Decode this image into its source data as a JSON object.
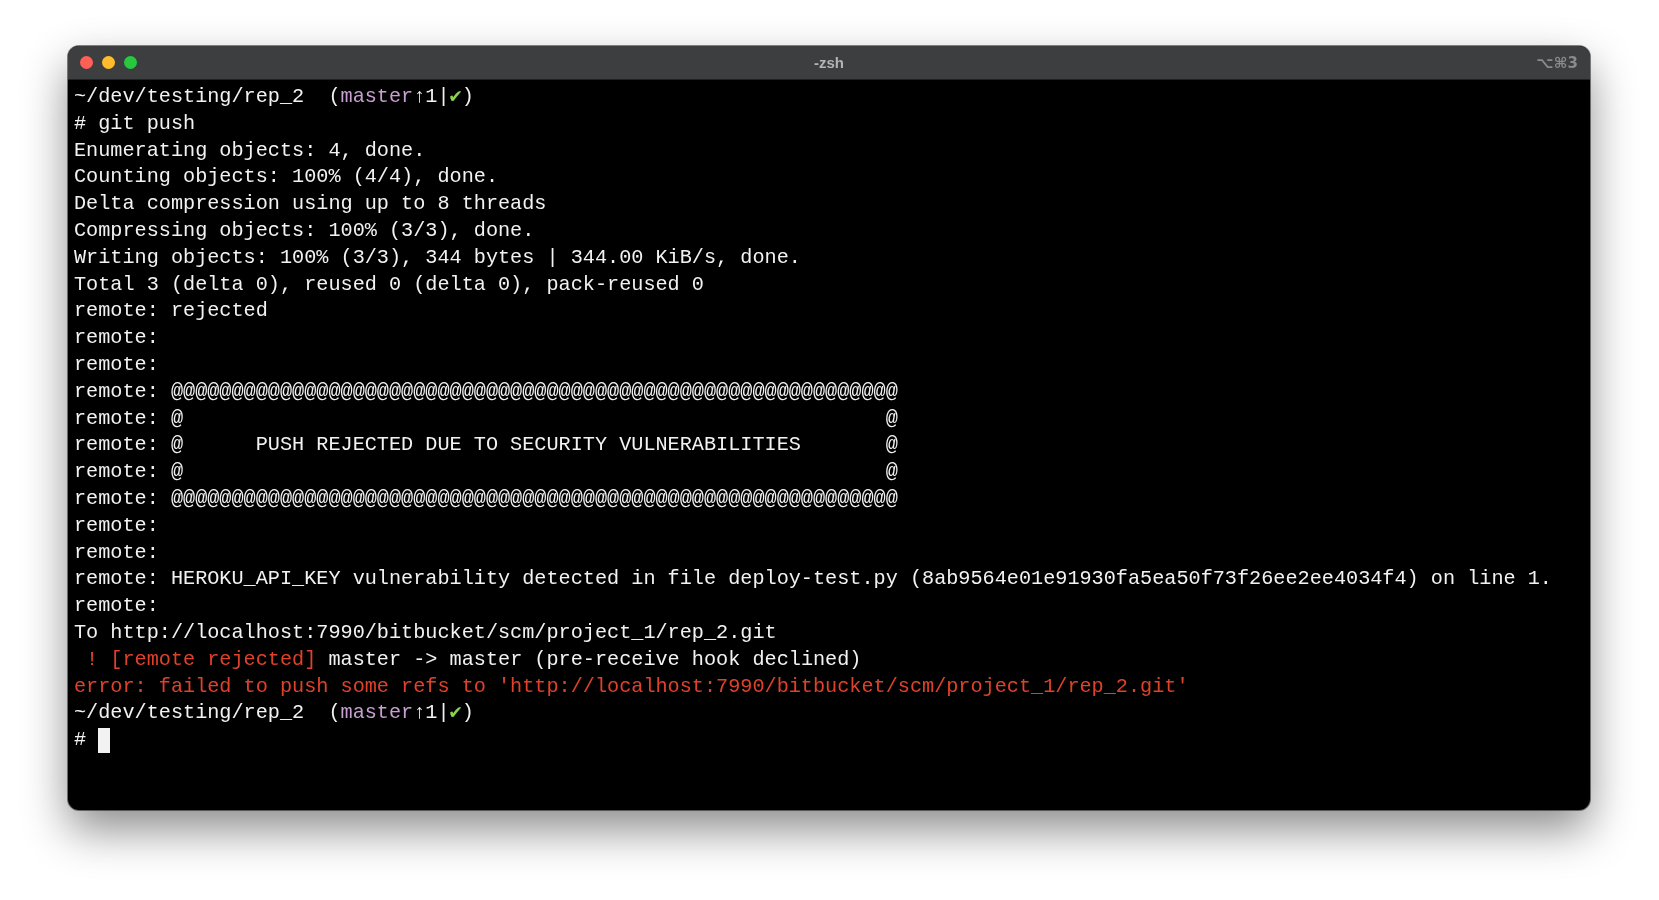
{
  "window": {
    "title": "-zsh",
    "shortcut": "⌥⌘3"
  },
  "lines": [
    {
      "segments": [
        {
          "kind": "plain",
          "text": "~/dev/testing/rep_2  ("
        },
        {
          "kind": "branch",
          "text": "master"
        },
        {
          "kind": "plain",
          "text": "↑1|"
        },
        {
          "kind": "ok",
          "text": "✔"
        },
        {
          "kind": "plain",
          "text": ")"
        }
      ]
    },
    {
      "segments": [
        {
          "kind": "plain",
          "text": "# git push"
        }
      ]
    },
    {
      "segments": [
        {
          "kind": "plain",
          "text": "Enumerating objects: 4, done."
        }
      ]
    },
    {
      "segments": [
        {
          "kind": "plain",
          "text": "Counting objects: 100% (4/4), done."
        }
      ]
    },
    {
      "segments": [
        {
          "kind": "plain",
          "text": "Delta compression using up to 8 threads"
        }
      ]
    },
    {
      "segments": [
        {
          "kind": "plain",
          "text": "Compressing objects: 100% (3/3), done."
        }
      ]
    },
    {
      "segments": [
        {
          "kind": "plain",
          "text": "Writing objects: 100% (3/3), 344 bytes | 344.00 KiB/s, done."
        }
      ]
    },
    {
      "segments": [
        {
          "kind": "plain",
          "text": "Total 3 (delta 0), reused 0 (delta 0), pack-reused 0"
        }
      ]
    },
    {
      "segments": [
        {
          "kind": "plain",
          "text": "remote: rejected"
        }
      ]
    },
    {
      "segments": [
        {
          "kind": "plain",
          "text": "remote:"
        }
      ]
    },
    {
      "segments": [
        {
          "kind": "plain",
          "text": "remote:"
        }
      ]
    },
    {
      "segments": [
        {
          "kind": "plain",
          "text": "remote: @@@@@@@@@@@@@@@@@@@@@@@@@@@@@@@@@@@@@@@@@@@@@@@@@@@@@@@@@@@@"
        }
      ]
    },
    {
      "segments": [
        {
          "kind": "plain",
          "text": "remote: @                                                          @"
        }
      ]
    },
    {
      "segments": [
        {
          "kind": "plain",
          "text": "remote: @      PUSH REJECTED DUE TO SECURITY VULNERABILITIES       @"
        }
      ]
    },
    {
      "segments": [
        {
          "kind": "plain",
          "text": "remote: @                                                          @"
        }
      ]
    },
    {
      "segments": [
        {
          "kind": "plain",
          "text": "remote: @@@@@@@@@@@@@@@@@@@@@@@@@@@@@@@@@@@@@@@@@@@@@@@@@@@@@@@@@@@@"
        }
      ]
    },
    {
      "segments": [
        {
          "kind": "plain",
          "text": "remote:"
        }
      ]
    },
    {
      "segments": [
        {
          "kind": "plain",
          "text": "remote:"
        }
      ]
    },
    {
      "segments": [
        {
          "kind": "plain",
          "text": "remote: HEROKU_API_KEY vulnerability detected in file deploy-test.py (8ab9564e01e91930fa5ea50f73f26ee2ee4034f4) on line 1."
        }
      ]
    },
    {
      "segments": [
        {
          "kind": "plain",
          "text": "remote:"
        }
      ]
    },
    {
      "segments": [
        {
          "kind": "plain",
          "text": "To http://localhost:7990/bitbucket/scm/project_1/rep_2.git"
        }
      ]
    },
    {
      "segments": [
        {
          "kind": "error",
          "text": " ! [remote rejected]"
        },
        {
          "kind": "plain",
          "text": " master -> master (pre-receive hook declined)"
        }
      ]
    },
    {
      "segments": [
        {
          "kind": "error",
          "text": "error: failed to push some refs to 'http://localhost:7990/bitbucket/scm/project_1/rep_2.git'"
        }
      ]
    },
    {
      "segments": [
        {
          "kind": "plain",
          "text": "~/dev/testing/rep_2  ("
        },
        {
          "kind": "branch",
          "text": "master"
        },
        {
          "kind": "plain",
          "text": "↑1|"
        },
        {
          "kind": "ok",
          "text": "✔"
        },
        {
          "kind": "plain",
          "text": ")"
        }
      ]
    },
    {
      "segments": [
        {
          "kind": "plain",
          "text": "# "
        },
        {
          "kind": "cursor"
        }
      ]
    }
  ]
}
